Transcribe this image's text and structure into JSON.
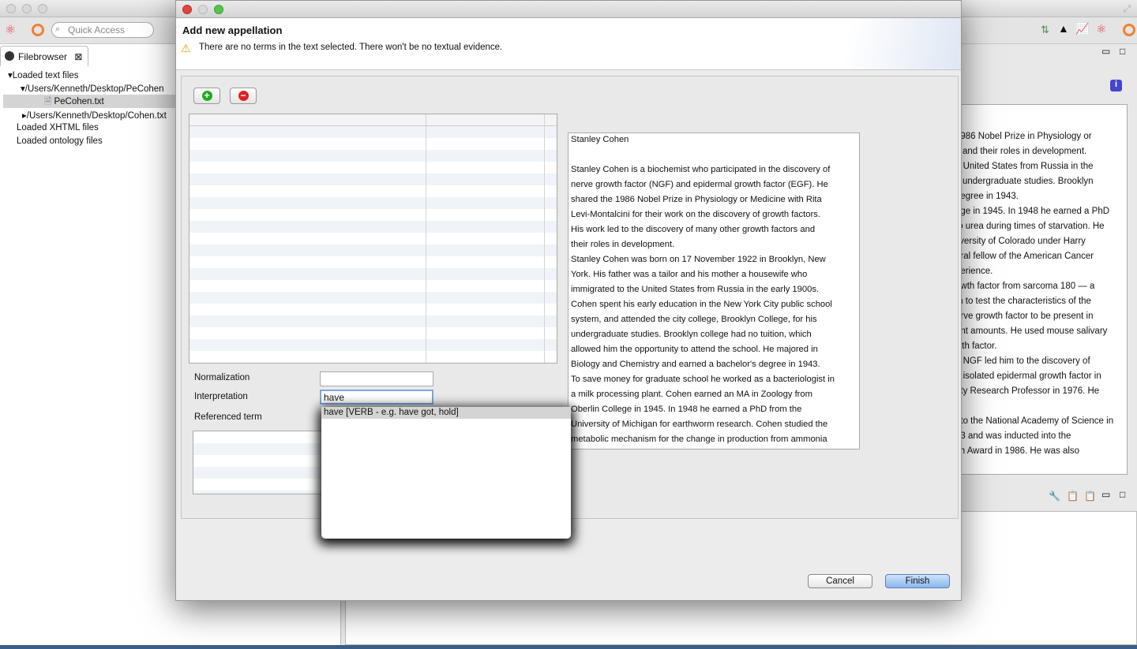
{
  "app": {
    "search_placeholder": "Quick Access"
  },
  "filebrowser": {
    "tab": "Filebrowser",
    "items": [
      "Loaded text files",
      "/Users/Kenneth/Desktop/PeCohen",
      "PeCohen.txt",
      "/Users/Kenneth/Desktop/Cohen.txt",
      "Loaded XHTML files",
      "Loaded ontology files"
    ]
  },
  "background_text": [
    "1986 Nobel Prize in Physiology or",
    "s and their roles in development.",
    "e United States from Russia in the",
    "s undergraduate studies.  Brooklyn",
    "degree in 1943.",
    "ege in 1945.  In 1948 he earned a PhD",
    "to urea during times of starvation.  He",
    "iiversity of Colorado under Harry",
    "oral fellow of the American Cancer",
    "perience.",
    "owth factor from sarcoma 180 — a",
    "m to test the characteristics of the",
    "erve growth factor to be present in",
    "ant amounts.  He used mouse salivary",
    "wth factor.",
    "n NGF led him to the discovery of",
    "e isolated epidermal growth factor in",
    "ety Research Professor in 1976.  He",
    "",
    "nto the National Academy of Science in",
    "83 and was inducted into the",
    "ch Award in 1986.  He was also"
  ],
  "dialog": {
    "title": "Add new appellation",
    "warning": "There are no terms in the text selected. There won't be no textual evidence.",
    "add_label": "+",
    "remove_label": "−",
    "document_lines": [
      "Stanley Cohen",
      "",
      "Stanley Cohen is a biochemist who participated in the discovery of",
      "nerve growth factor (NGF) and epidermal growth factor (EGF).  He",
      "shared the 1986 Nobel Prize in Physiology or Medicine with Rita",
      "Levi-Montalcini for their work on the discovery of growth factors.",
      "His work led to the discovery of many other growth factors and",
      "their roles in development.",
      "Stanley Cohen was born on 17 November 1922 in Brooklyn, New",
      "York.  His father was a tailor and his mother a housewife who",
      "immigrated to the United States from Russia in the early 1900s.",
      "Cohen spent his early education in the New York City public school",
      "system, and attended the city college, Brooklyn College, for his",
      "undergraduate studies.  Brooklyn college had no tuition, which",
      "allowed him the opportunity to attend the school.   He majored in",
      "Biology and Chemistry and earned a bachelor's degree in 1943.",
      "To save money for graduate school he worked as a bacteriologist in",
      "a milk processing plant.  Cohen earned an MA in Zoology from",
      "Oberlin College in 1945.  In 1948 he earned a PhD from the",
      "University of Michigan for earthworm research.  Cohen studied the",
      "metabolic mechanism for the change in production from ammonia"
    ],
    "normalization_label": "Normalization",
    "normalization_value": "",
    "interpretation_label": "Interpretation",
    "interpretation_value": "have",
    "referenced_term_label": "Referenced term",
    "suggestions": [
      "have [VERB - e.g. have got, hold]"
    ],
    "cancel": "Cancel",
    "finish": "Finish"
  }
}
